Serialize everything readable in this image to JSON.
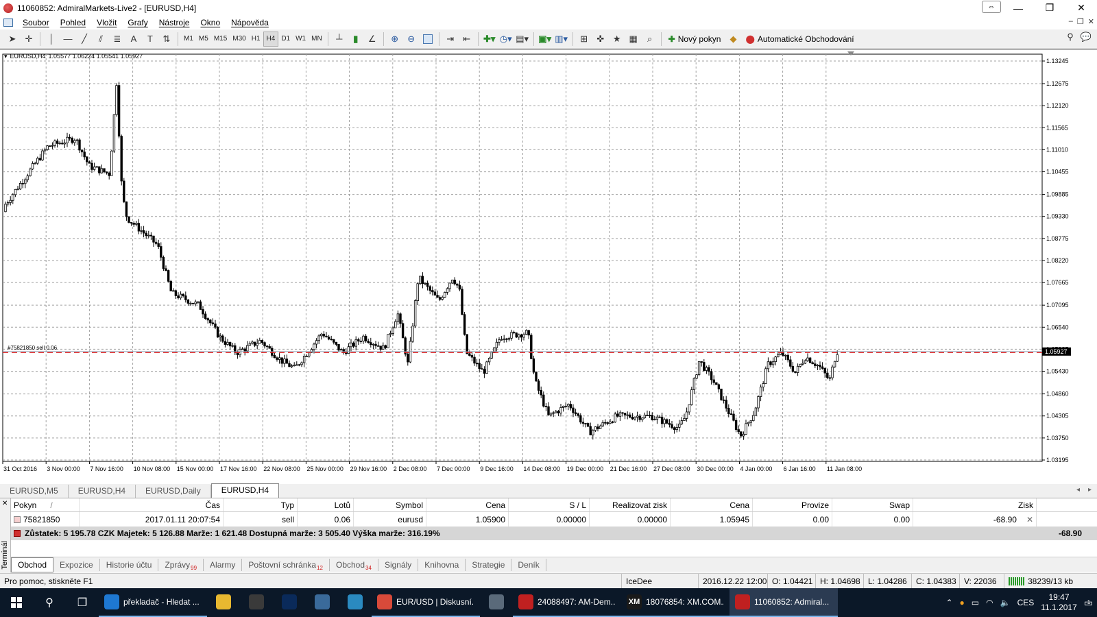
{
  "window": {
    "title": "11060852: AdmiralMarkets-Live2 - [EURUSD,H4]"
  },
  "menu": [
    "Soubor",
    "Pohled",
    "Vložit",
    "Grafy",
    "Nástroje",
    "Okno",
    "Nápověda"
  ],
  "toolbar": {
    "periods": [
      "M1",
      "M5",
      "M15",
      "M30",
      "H1",
      "H4",
      "D1",
      "W1",
      "MN"
    ],
    "active_period": "H4",
    "new_order_label": "Nový pokyn",
    "auto_trading_label": "Automatické Obchodování"
  },
  "chart": {
    "symbol_label": "EURUSD,H4",
    "ohlc": "1.05577 1.06224 1.05541 1.05927",
    "order_line_label": "#75821850 sell 0.06",
    "current_price": "1.05927",
    "price_ticks": [
      "1.13245",
      "1.12675",
      "1.12120",
      "1.11565",
      "1.11010",
      "1.10455",
      "1.09885",
      "1.09330",
      "1.08775",
      "1.08220",
      "1.07665",
      "1.07095",
      "1.06540",
      "1.05985",
      "1.05430",
      "1.04860",
      "1.04305",
      "1.03750",
      "1.03195"
    ],
    "time_ticks": [
      "31 Oct 2016",
      "3 Nov 00:00",
      "7 Nov 16:00",
      "10 Nov 08:00",
      "15 Nov 00:00",
      "17 Nov 16:00",
      "22 Nov 08:00",
      "25 Nov 00:00",
      "29 Nov 16:00",
      "2 Dec 08:00",
      "7 Dec 00:00",
      "9 Dec 16:00",
      "14 Dec 08:00",
      "19 Dec 00:00",
      "21 Dec 16:00",
      "27 Dec 08:00",
      "30 Dec 00:00",
      "4 Jan 00:00",
      "6 Jan 16:00",
      "11 Jan 08:00"
    ],
    "colors": {
      "order_line": "#e02020",
      "grid": "#a0a0a0",
      "candle": "#000000"
    }
  },
  "chart_tabs": [
    "EURUSD,M5",
    "EURUSD,H4",
    "EURUSD,Daily",
    "EURUSD,H4"
  ],
  "active_chart_tab": 3,
  "terminal": {
    "side_label": "Terminál",
    "columns": [
      "Pokyn",
      "/",
      "Čas",
      "Typ",
      "Lotů",
      "Symbol",
      "Cena",
      "S / L",
      "Realizovat zisk",
      "Cena",
      "Provize",
      "Swap",
      "Zisk"
    ],
    "order": {
      "id": "75821850",
      "time": "2017.01.11 20:07:54",
      "type": "sell",
      "lots": "0.06",
      "symbol": "eurusd",
      "open_price": "1.05900",
      "sl": "0.00000",
      "tp": "0.00000",
      "price": "1.05945",
      "commission": "0.00",
      "swap": "0.00",
      "profit": "-68.90"
    },
    "balance_text": "Zůstatek: 5 195.78 CZK  Majetek: 5 126.88  Marže: 1 621.48  Dostupná marže: 3 505.40  Výška marže: 316.19%",
    "balance_profit": "-68.90",
    "tabs": [
      {
        "label": "Obchod",
        "badge": ""
      },
      {
        "label": "Expozice",
        "badge": ""
      },
      {
        "label": "Historie účtu",
        "badge": ""
      },
      {
        "label": "Zprávy",
        "badge": "99"
      },
      {
        "label": "Alarmy",
        "badge": ""
      },
      {
        "label": "Poštovní schránka",
        "badge": "12"
      },
      {
        "label": "Obchod",
        "badge": "34"
      },
      {
        "label": "Signály",
        "badge": ""
      },
      {
        "label": "Knihovna",
        "badge": ""
      },
      {
        "label": "Strategie",
        "badge": ""
      },
      {
        "label": "Deník",
        "badge": ""
      }
    ]
  },
  "statusbar": {
    "help": "Pro pomoc, stiskněte F1",
    "profile": "IceDee",
    "datetime": "2016.12.22 12:00",
    "open": "O: 1.04421",
    "high": "H: 1.04698",
    "low": "L: 1.04286",
    "close": "C: 1.04383",
    "volume": "V: 22036",
    "traffic": "38239/13 kb"
  },
  "taskbar": {
    "apps": [
      {
        "label": "překladač - Hledat ...",
        "icon": "edge-icon",
        "color": "#1e78d2"
      },
      {
        "label": "",
        "icon": "folder-icon",
        "color": "#e8b830"
      },
      {
        "label": "",
        "icon": "store-icon",
        "color": "#3a3a3a"
      },
      {
        "label": "",
        "icon": "photoshop-icon",
        "color": "#0a2a5a"
      },
      {
        "label": "",
        "icon": "thunderbird-icon",
        "color": "#3a6a9a"
      },
      {
        "label": "",
        "icon": "xbs-icon",
        "color": "#2a8ac0"
      },
      {
        "label": "EUR/USD | Diskusní...",
        "icon": "chrome-icon",
        "color": "#d84a3a"
      },
      {
        "label": "",
        "icon": "printer-icon",
        "color": "#5a6a7a"
      },
      {
        "label": "24088497: AM-Dem...",
        "icon": "mt4-icon",
        "color": "#c02020"
      },
      {
        "label": "18076854: XM.COM...",
        "icon": "xm-icon",
        "color": "#1a1a1a"
      },
      {
        "label": "11060852: Admiral...",
        "icon": "mt4-icon",
        "color": "#c02020"
      }
    ],
    "xm_logo": "XM",
    "lang": "CES",
    "time": "19:47",
    "date": "11.1.2017",
    "notif_count": "1"
  }
}
